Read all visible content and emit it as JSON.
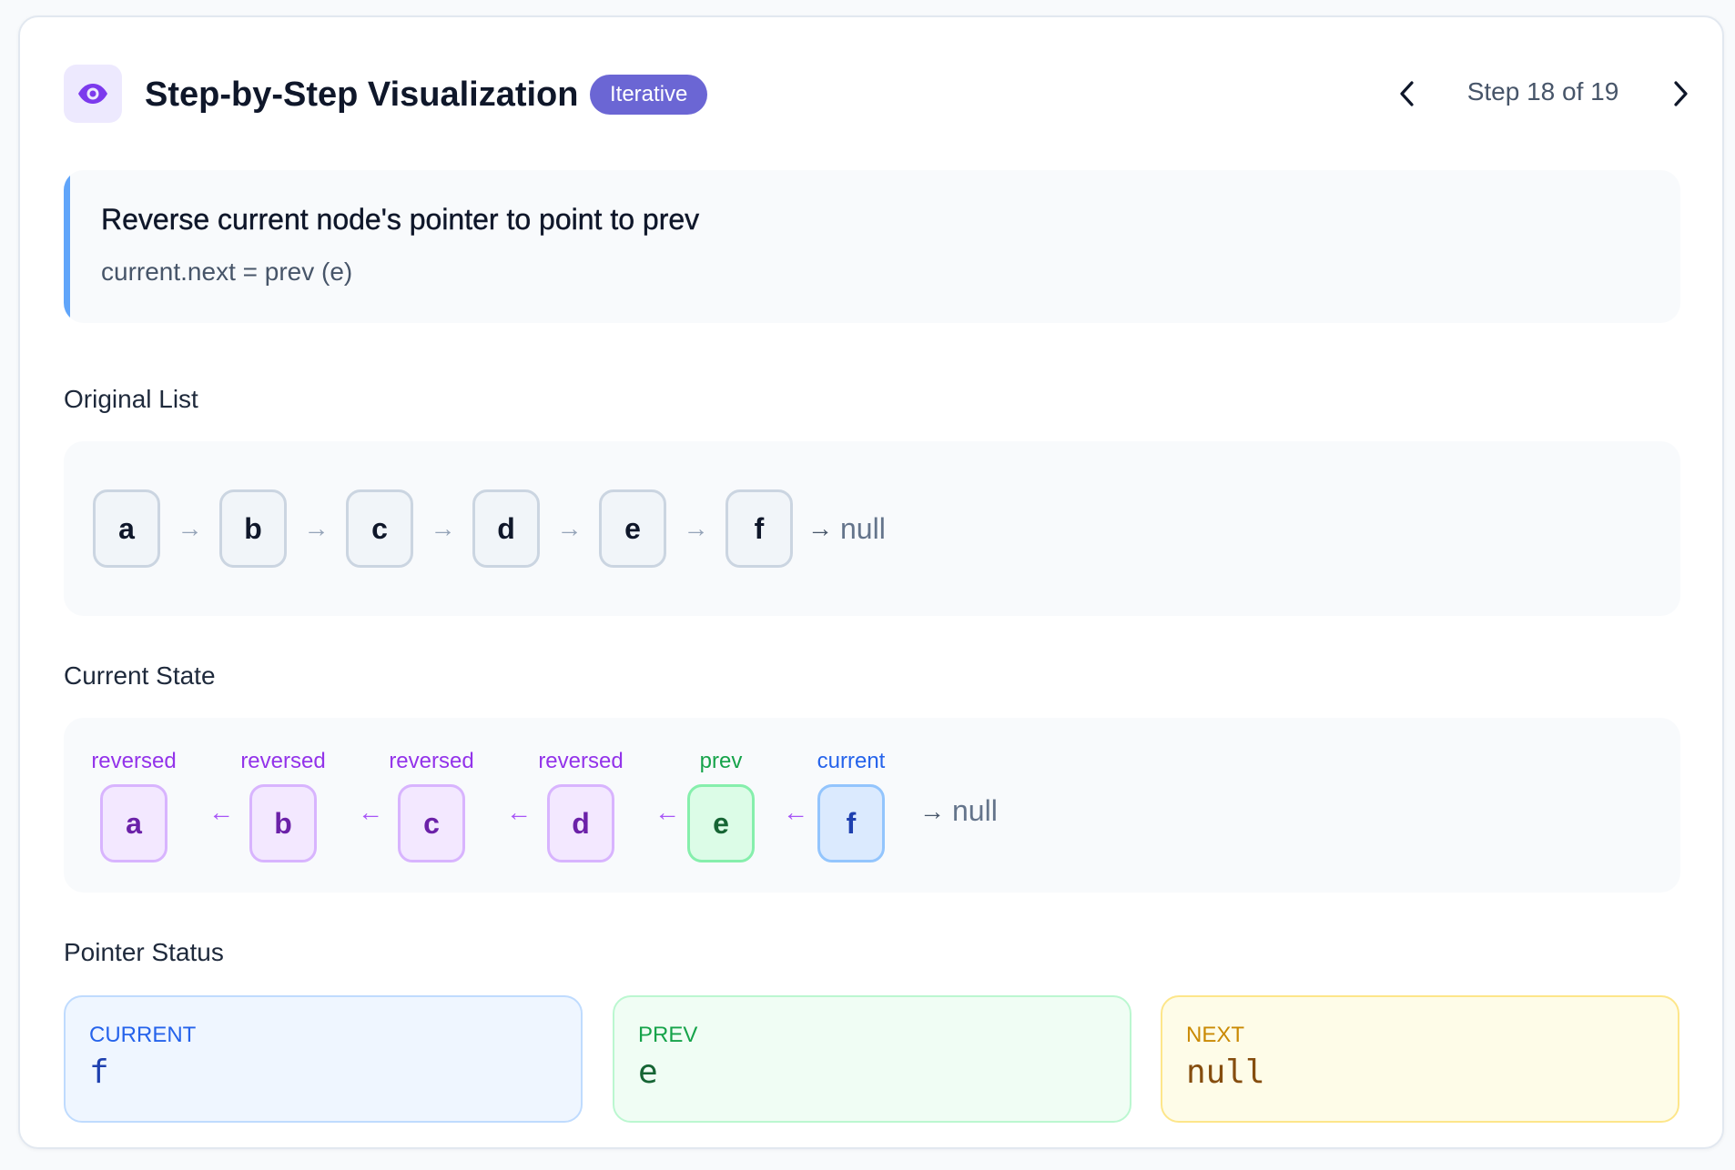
{
  "header": {
    "icon": "eye-icon",
    "title": "Step-by-Step Visualization",
    "badge": "Iterative",
    "step_label": "Step 18 of 19"
  },
  "description": {
    "title": "Reverse current node's pointer to point to prev",
    "code": "current.next = prev (e)"
  },
  "original_list": {
    "section_title": "Original List",
    "nodes": [
      "a",
      "b",
      "c",
      "d",
      "e",
      "f"
    ],
    "arrow": "→",
    "terminal": "null"
  },
  "current_state": {
    "section_title": "Current State",
    "nodes": [
      {
        "value": "a",
        "label": "reversed"
      },
      {
        "value": "b",
        "label": "reversed"
      },
      {
        "value": "c",
        "label": "reversed"
      },
      {
        "value": "d",
        "label": "reversed"
      },
      {
        "value": "e",
        "label": "prev"
      },
      {
        "value": "f",
        "label": "current"
      }
    ],
    "arrow": "←",
    "terminal_arrow": "→",
    "terminal": "null"
  },
  "pointer_status": {
    "section_title": "Pointer Status",
    "current": {
      "label": "CURRENT",
      "value": "f"
    },
    "prev": {
      "label": "PREV",
      "value": "e"
    },
    "next": {
      "label": "NEXT",
      "value": "null"
    }
  },
  "colors": {
    "accent": "#6b66d4",
    "reversed": "#9333ea",
    "prev": "#16a34a",
    "current": "#2563eb",
    "next": "#ca8a04"
  }
}
